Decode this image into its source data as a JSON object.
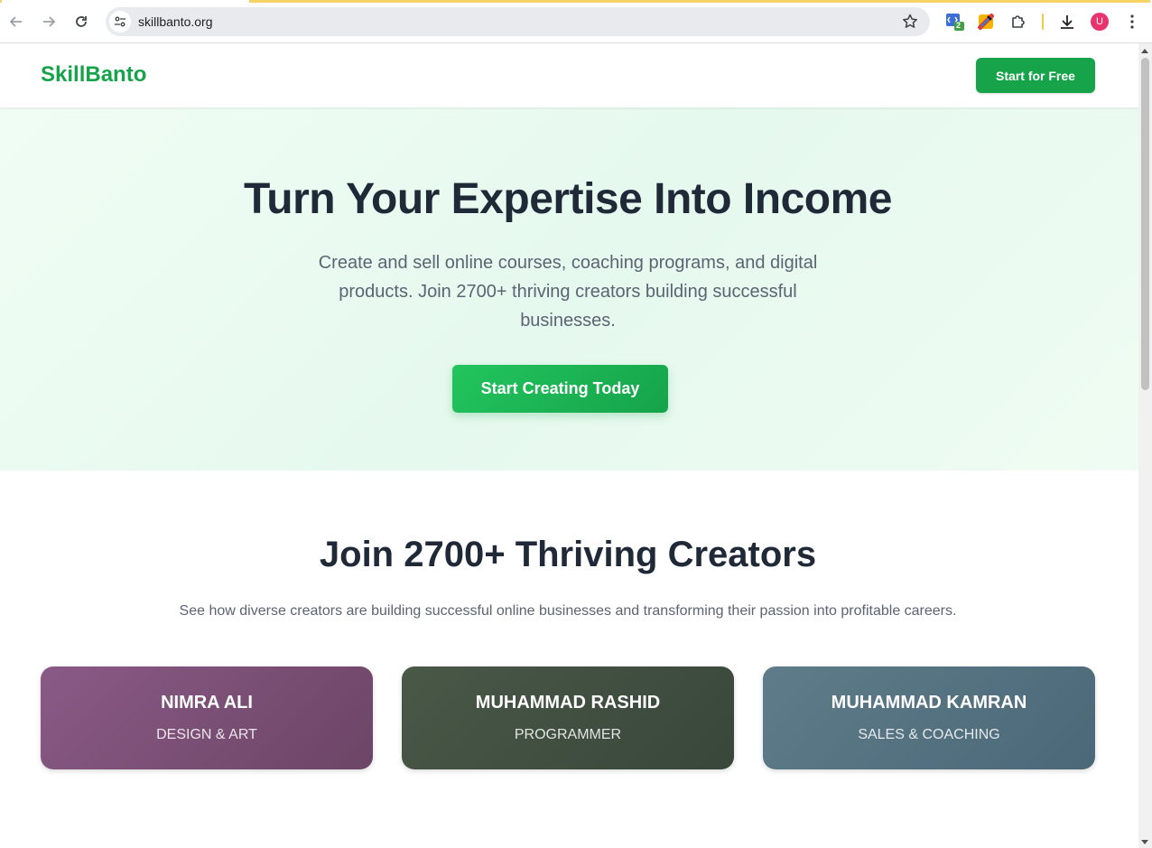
{
  "browser": {
    "url": "skillbanto.org",
    "extension_badge": "2",
    "profile_initial": "U"
  },
  "header": {
    "logo": "SkillBanto",
    "cta_label": "Start for Free"
  },
  "hero": {
    "title": "Turn Your Expertise Into Income",
    "subtitle": "Create and sell online courses, coaching programs, and digital products. Join 2700+ thriving creators building successful businesses.",
    "cta_label": "Start Creating Today"
  },
  "creators": {
    "title": "Join 2700+ Thriving Creators",
    "subtitle": "See how diverse creators are building successful online businesses and transforming their passion into profitable careers.",
    "cards": [
      {
        "name": "NIMRA ALI",
        "role": "DESIGN & ART",
        "color": "#7e4f7a"
      },
      {
        "name": "MUHAMMAD RASHID",
        "role": "PROGRAMMER",
        "color": "#414f40"
      },
      {
        "name": "MUHAMMAD KAMRAN",
        "role": "SALES & COACHING",
        "color": "#56717f"
      }
    ]
  },
  "colors": {
    "brand_green": "#16a34a",
    "hero_bg": "#eafaf0",
    "heading": "#1f2937",
    "body_text": "#5b6472"
  }
}
